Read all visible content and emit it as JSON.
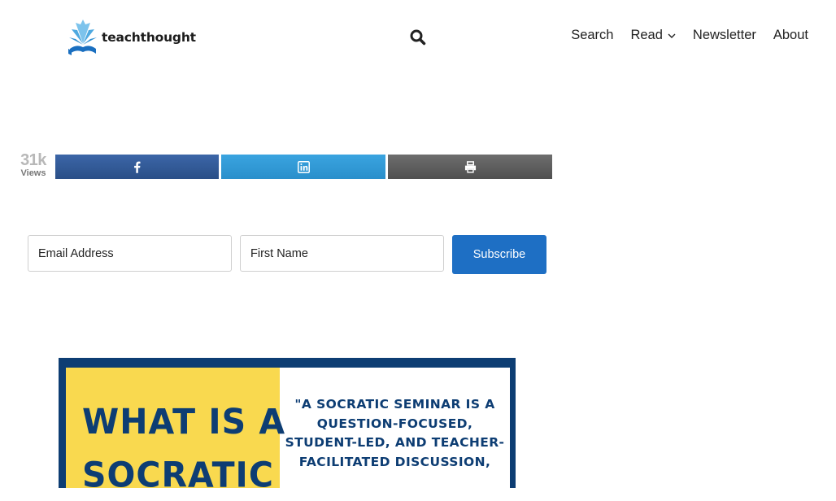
{
  "header": {
    "logo_text": "teachthought",
    "nav": {
      "search": "Search",
      "read": "Read",
      "newsletter": "Newsletter",
      "about": "About"
    }
  },
  "share": {
    "views_count": "31k",
    "views_label": "Views",
    "buttons": [
      "facebook-icon",
      "linkedin-icon",
      "print-icon"
    ]
  },
  "subscribe": {
    "email_placeholder": "Email Address",
    "first_name_placeholder": "First Name",
    "button_label": "Subscribe"
  },
  "featured_image": {
    "title_line1": "WHAT IS A",
    "title_line2": "SOCRATIC",
    "quote_line1": "\"A SOCRATIC SEMINAR IS A",
    "quote_line2": "QUESTION-FOCUSED,",
    "quote_line3": "STUDENT-LED, AND TEACHER-",
    "quote_line4": "FACILITATED DISCUSSION,"
  },
  "colors": {
    "facebook": "#2f5a96",
    "linkedin": "#2f98d4",
    "print": "#5c5c5c",
    "subscribe": "#1e6fc4",
    "navy": "#0d3d73",
    "yellow": "#f9d94f"
  }
}
